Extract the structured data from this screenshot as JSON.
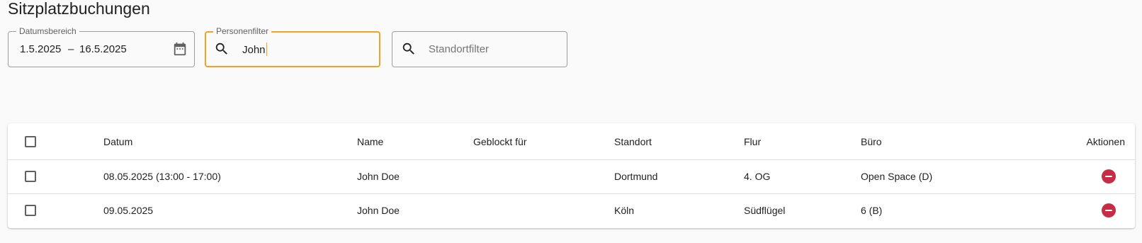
{
  "page": {
    "title": "Sitzplatzbuchungen"
  },
  "filters": {
    "date_range": {
      "label": "Datumsbereich",
      "start": "1.5.2025",
      "separator": "–",
      "end": "16.5.2025",
      "icon": "calendar-icon"
    },
    "person": {
      "label": "Personenfilter",
      "value": "John",
      "icon": "search-icon",
      "focused": true
    },
    "location": {
      "placeholder": "Standortfilter",
      "value": "",
      "icon": "search-icon"
    }
  },
  "table": {
    "columns": {
      "datum": "Datum",
      "name": "Name",
      "geblockt": "Geblockt für",
      "standort": "Standort",
      "flur": "Flur",
      "buero": "Büro",
      "aktionen": "Aktionen"
    },
    "rows": [
      {
        "datum": "08.05.2025 (13:00 - 17:00)",
        "name": "John Doe",
        "geblockt": "",
        "standort": "Dortmund",
        "flur": "4. OG",
        "buero": "Open Space (D)",
        "action_icon": "remove-circle-icon"
      },
      {
        "datum": "09.05.2025",
        "name": "John Doe",
        "geblockt": "",
        "standort": "Köln",
        "flur": "Südflügel",
        "buero": "6 (B)",
        "action_icon": "remove-circle-icon"
      }
    ]
  },
  "colors": {
    "accent": "#f0a324",
    "danger": "#c62d44",
    "background": "#fafafa",
    "text": "#212121"
  }
}
